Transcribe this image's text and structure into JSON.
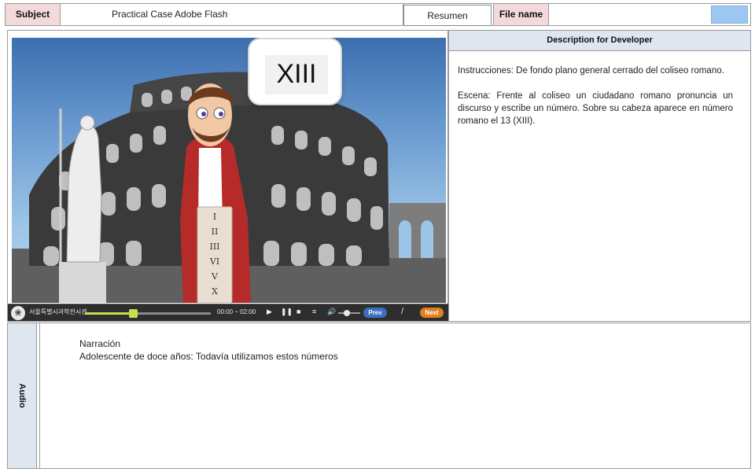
{
  "header": {
    "subject_label": "Subject",
    "subject_value": "Practical Case Adobe Flash",
    "resumen_button": "Resumen",
    "file_label": "File name",
    "file_value": ""
  },
  "scene": {
    "bubble_text": "XIII",
    "tablet_numerals": [
      "I",
      "II",
      "III",
      "VI",
      "V",
      "X"
    ]
  },
  "player": {
    "org_name": "서울특별시과학전시관",
    "time": "00:00 ~ 02:00",
    "progress": 0.38,
    "volume": 0.4,
    "prev_label": "Prev",
    "separator": "/",
    "next_label": "Next",
    "icons": [
      "play-icon",
      "pause-icon",
      "stop-icon",
      "menu-icon",
      "volume-icon"
    ]
  },
  "description": {
    "title": "Description for Developer",
    "paragraph1": "Instrucciones: De fondo plano general cerrado del coliseo romano.",
    "paragraph2": "Escena: Frente al coliseo un ciudadano romano pronuncia un discurso y escribe un número. Sobre su cabeza aparece en número romano el 13 (XIII)."
  },
  "audio": {
    "label": "Audio",
    "line1": "Narración",
    "line2": "Adolescente de doce años: Todavía utilizamos estos números"
  },
  "colors": {
    "label_pink": "#f3d9d9",
    "label_blue": "#dfe6f0",
    "accent_blue": "#9cc7f3",
    "prev_blue": "#3b6fc0",
    "next_orange": "#e07f1c",
    "progress_green": "#c5e04b"
  }
}
